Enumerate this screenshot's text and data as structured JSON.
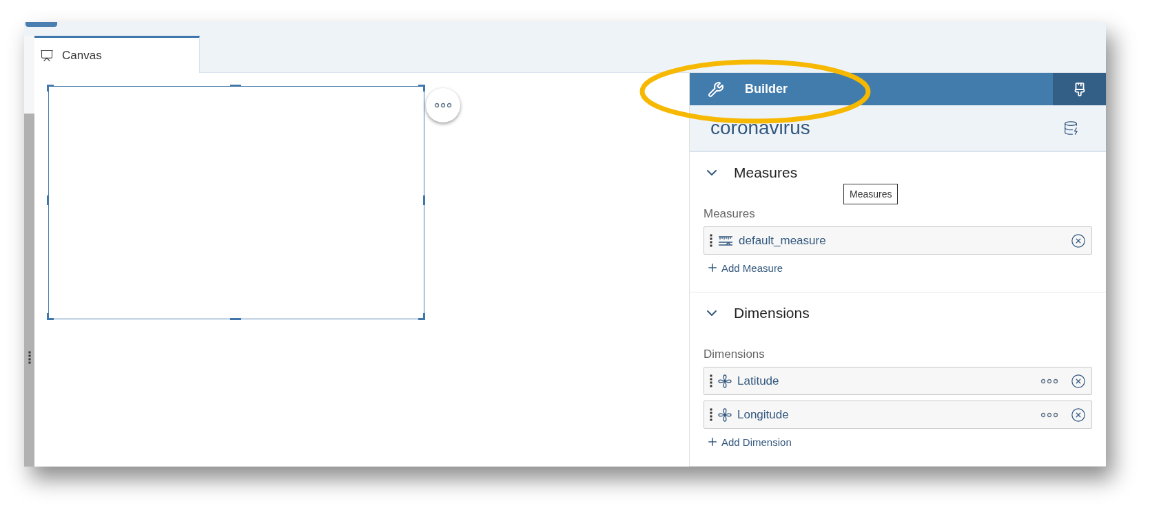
{
  "tabs": [
    {
      "label": "Canvas",
      "selected": true
    }
  ],
  "builder": {
    "title": "Builder",
    "model": "coronavirus",
    "sections": [
      {
        "title": "Measures",
        "expanded": true,
        "field_label": "Measures",
        "add_label": "Add Measure",
        "items": [
          {
            "name": "default_measure",
            "kind": "measure"
          }
        ]
      },
      {
        "title": "Dimensions",
        "expanded": true,
        "field_label": "Dimensions",
        "add_label": "Add Dimension",
        "items": [
          {
            "name": "Latitude",
            "kind": "dimension"
          },
          {
            "name": "Longitude",
            "kind": "dimension"
          }
        ]
      }
    ]
  },
  "tooltip": "Measures"
}
